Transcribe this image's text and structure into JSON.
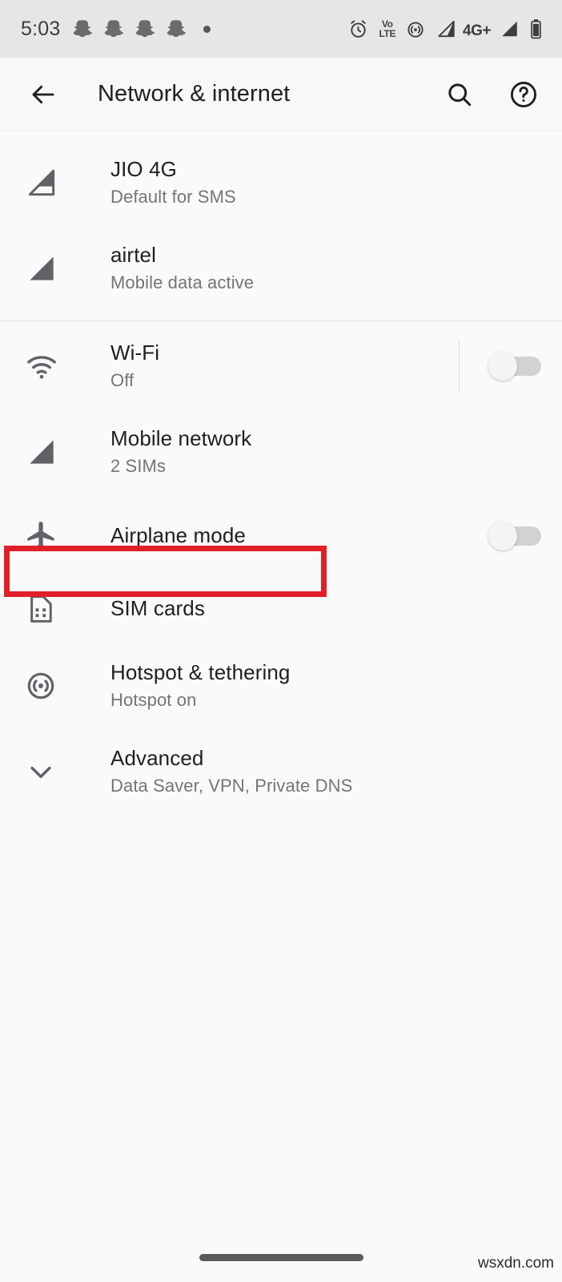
{
  "status_bar": {
    "time": "5:03",
    "notification_icons": [
      "snapchat-ghost-icon",
      "snapchat-ghost-icon",
      "snapchat-ghost-icon",
      "snapchat-ghost-icon"
    ],
    "overflow_indicator": "more-notifications-dot",
    "right_icons": [
      {
        "name": "alarm-clock-icon",
        "label": ""
      },
      {
        "name": "volte-icon",
        "label_top": "Vo",
        "label_bottom": "LTE"
      },
      {
        "name": "hotspot-icon",
        "label": ""
      },
      {
        "name": "signal-sim1-icon",
        "label": ""
      },
      {
        "name": "network-type-icon",
        "label": "4G+"
      },
      {
        "name": "signal-sim2-icon",
        "label": ""
      },
      {
        "name": "battery-icon",
        "label": ""
      }
    ],
    "background_color": "#e6e6e6"
  },
  "app_bar": {
    "back_label": "back-arrow",
    "title": "Network & internet",
    "search_label": "search-icon",
    "help_label": "help-icon",
    "background_color": "#f8f8f8"
  },
  "list": {
    "sim_section": [
      {
        "icon": "signal-outline-icon",
        "title": "JIO 4G",
        "subtitle": "Default for SMS",
        "has_toggle": false
      },
      {
        "icon": "signal-filled-icon",
        "title": "airtel",
        "subtitle": "Mobile data active",
        "has_toggle": false
      }
    ],
    "main_section": [
      {
        "icon": "wifi-icon",
        "title": "Wi-Fi",
        "subtitle": "Off",
        "has_toggle": true,
        "toggle_on": false,
        "has_divider": true
      },
      {
        "icon": "signal-filled-icon",
        "title": "Mobile network",
        "subtitle": "2 SIMs",
        "has_toggle": false
      },
      {
        "icon": "airplane-icon",
        "title": "Airplane mode",
        "subtitle": "",
        "has_toggle": true,
        "toggle_on": false,
        "has_divider": false
      },
      {
        "icon": "sim-card-icon",
        "title": "SIM cards",
        "subtitle": "",
        "has_toggle": false,
        "highlighted": true
      },
      {
        "icon": "hotspot-icon",
        "title": "Hotspot & tethering",
        "subtitle": "Hotspot on",
        "has_toggle": false
      },
      {
        "icon": "chevron-down-icon",
        "title": "Advanced",
        "subtitle": "Data Saver, VPN, Private DNS",
        "has_toggle": false
      }
    ]
  },
  "annotation": {
    "highlight_color": "#e01f26",
    "target": "SIM cards"
  },
  "watermark": {
    "text": "wsxdn.com"
  },
  "nav_bar": {
    "home_pill": "home-gesture-pill"
  }
}
